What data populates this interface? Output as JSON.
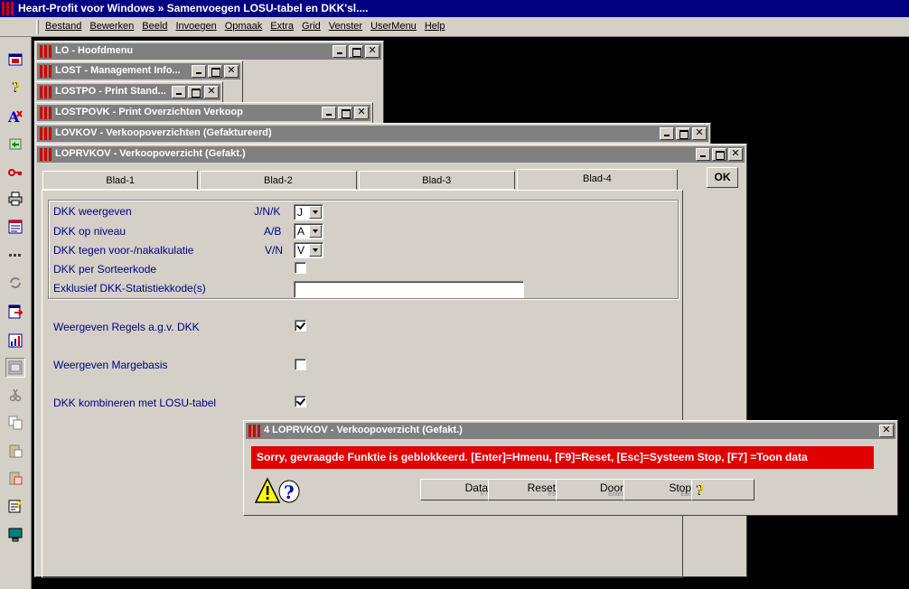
{
  "app": {
    "title": "Heart-Profit voor Windows  »  Samenvoegen LOSU-tabel en DKK'sl...."
  },
  "menu": [
    "Bestand",
    "Bewerken",
    "Beeld",
    "Invoegen",
    "Opmaak",
    "Extra",
    "Grid",
    "Venster",
    "UserMenu",
    "Help"
  ],
  "toolbar_icons": [
    "window-icon",
    "help-question-icon",
    "text-format-icon",
    "import-icon",
    "key-icon",
    "print-icon",
    "form-icon",
    "dots-icon",
    "refresh-icon",
    "export-icon",
    "chart-icon",
    "panel-icon",
    "scissors-icon",
    "copy-icon",
    "paste-icon",
    "paste-special-icon",
    "properties-icon",
    "monitor-icon"
  ],
  "windows": {
    "lo": "LO - Hoofdmenu",
    "lost": "LOST - Management Info...",
    "lostpo": "LOSTPO - Print Stand...",
    "lostpovk": "LOSTPOVK - Print Overzichten Verkoop",
    "lovkov": "LOVKOV - Verkoopoverzichten (Gefaktureerd)",
    "loprvkov": "LOPRVKOV - Verkoopoverzicht (Gefakt.)"
  },
  "tabs": [
    "Blad-1",
    "Blad-2",
    "Blad-3",
    "Blad-4"
  ],
  "ok_label": "OK",
  "form": {
    "dkk_weergeven": {
      "label": "DKK weergeven",
      "hint": "J/N/K",
      "value": "J"
    },
    "dkk_op_niveau": {
      "label": "DKK op niveau",
      "hint": "A/B",
      "value": "A"
    },
    "dkk_tegen": {
      "label": "DKK tegen voor-/nakalkulatie",
      "hint": "V/N",
      "value": "V"
    },
    "dkk_per_sorteer": {
      "label": "DKK per Sorteerkode",
      "checked": false
    },
    "exklusief": {
      "label": "Exklusief DKK-Statistiekkode(s)",
      "value": ""
    },
    "weergeven_regels": {
      "label": "Weergeven Regels a.g.v. DKK",
      "checked": true
    },
    "weergeven_marge": {
      "label": "Weergeven Margebasis",
      "checked": false
    },
    "dkk_kombineren": {
      "label": "DKK kombineren met LOSU-tabel",
      "checked": true
    }
  },
  "dialog": {
    "title": "4 LOPRVKOV - Verkoopoverzicht (Gefakt.)",
    "message": "Sorry, gevraagde Funktie is geblokkeerd.  [Enter]=Hmenu, [F9]=Reset, [Esc]=Systeem Stop, [F7] =Toon data",
    "buttons": [
      {
        "label": "Data",
        "key": "F7"
      },
      {
        "label": "Reset",
        "key": "F9"
      },
      {
        "label": "Door",
        "key": "Enter"
      },
      {
        "label": "Stop",
        "key": "Esc"
      }
    ]
  }
}
